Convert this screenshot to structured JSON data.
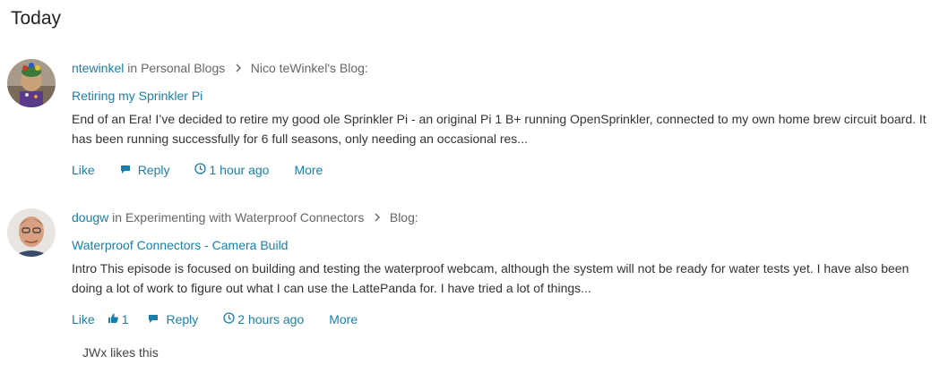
{
  "section": {
    "title": "Today"
  },
  "posts": [
    {
      "author": "ntewinkel",
      "in_word": "in",
      "place": "Personal Blogs",
      "blog": "Nico teWinkel's Blog:",
      "title": "Retiring my Sprinkler Pi",
      "excerpt": "End of an Era!   I’ve decided to retire my good ole Sprinkler Pi - an original Pi 1 B+ running OpenSprinkler, connected to my own home brew circuit board. It has been running successfully for 6 full seasons, only needing an occasional res...",
      "like_label": "Like",
      "like_count": "",
      "reply_label": "Reply",
      "time": "1 hour ago",
      "more_label": "More",
      "likes_text": ""
    },
    {
      "author": "dougw",
      "in_word": "in",
      "place": "Experimenting with Waterproof Connectors",
      "blog": "Blog:",
      "title": "Waterproof Connectors - Camera Build",
      "excerpt": "Intro This episode is focused on building and testing the waterproof webcam, although the system will not be ready for water tests yet. I have also been doing a lot of work to figure out what I can use the LattePanda for. I have tried a lot of things...",
      "like_label": "Like",
      "like_count": "1",
      "reply_label": "Reply",
      "time": "2 hours ago",
      "more_label": "More",
      "likes_text": "JWx likes this"
    }
  ],
  "icons": {
    "reply": "reply-bubble-icon",
    "clock": "clock-icon",
    "thumb": "thumbs-up-icon",
    "chevron": "chevron-right-icon"
  },
  "colors": {
    "link": "#1a7fa8",
    "text": "#333333",
    "meta": "#666666"
  }
}
